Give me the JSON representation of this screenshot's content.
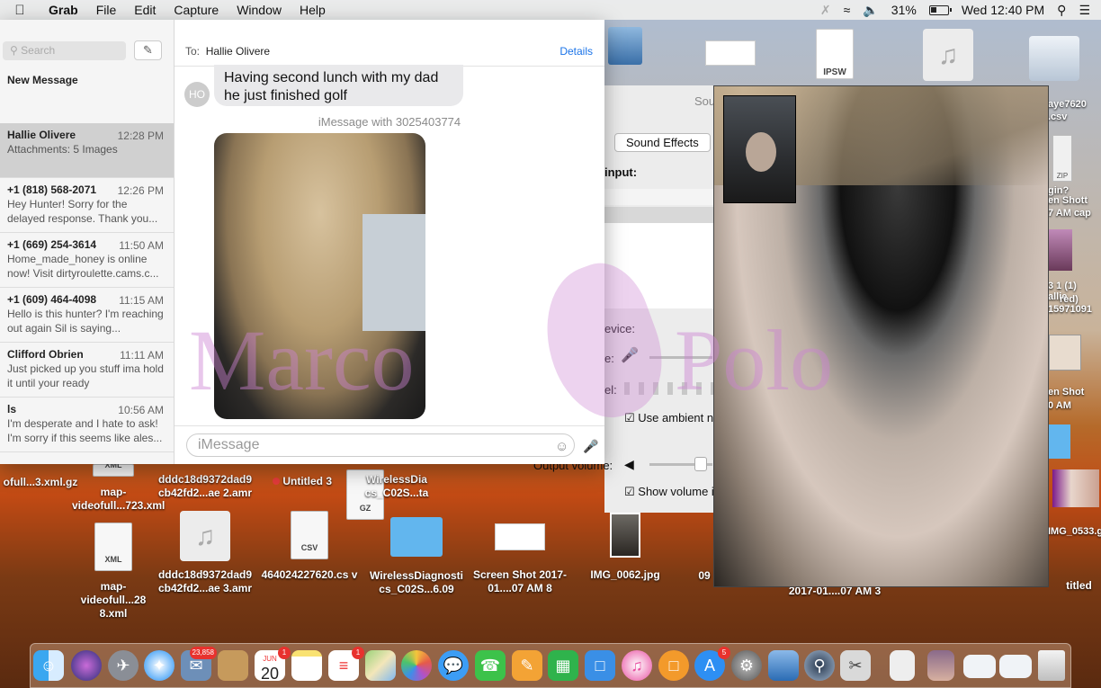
{
  "menubar": {
    "apple": "",
    "app_name": "Grab",
    "items": [
      "File",
      "Edit",
      "Capture",
      "Window",
      "Help"
    ],
    "battery": "31%",
    "clock": "Wed 12:40 PM"
  },
  "messages": {
    "search_placeholder": "Search",
    "new_message": "New Message",
    "conversations": [
      {
        "name": "Hallie Olivere",
        "time": "12:28 PM",
        "preview": "Attachments: 5 Images"
      },
      {
        "name": "+1 (818) 568-2071",
        "time": "12:26 PM",
        "preview": "Hey Hunter!  Sorry for the delayed response. Thank you..."
      },
      {
        "name": "+1 (669) 254-3614",
        "time": "11:50 AM",
        "preview": "Home_made_honey is online now! Visit dirtyroulette.cams.c..."
      },
      {
        "name": "+1 (609) 464-4098",
        "time": "11:15 AM",
        "preview": "Hello is this hunter?  I'm reaching out again Sil is saying..."
      },
      {
        "name": "Clifford Obrien",
        "time": "11:11 AM",
        "preview": "Just picked up you stuff ima hold it until your ready"
      },
      {
        "name": "ls",
        "time": "10:56 AM",
        "preview": "I'm desperate and I hate to ask! I'm sorry if this seems like ales..."
      }
    ],
    "to_label": "To:",
    "to_value": "Hallie Olivere",
    "details": "Details",
    "avatar_initials": "HO",
    "bubble_text": "Having second lunch with my dad he just finished golf",
    "imessage_header": "iMessage with 3025403774",
    "input_placeholder": "iMessage"
  },
  "sound_prefs": {
    "title": "Sou",
    "tab_label": "Sound Effects",
    "input_label": "input:",
    "device_label": "evice:",
    "e_label": "e:",
    "el_label": "el:",
    "ambient_label": "Use ambient n",
    "output_label": "Output volume:",
    "showvol_label": "Show volume i"
  },
  "desktop": {
    "row1": [
      {
        "label": "ofull...3.xml.gz"
      },
      {
        "label": "map-videofull...723.xml"
      },
      {
        "label": "dddc18d9372dad9 cb42fd2...ae 2.amr"
      },
      {
        "label": "Untitled 3"
      },
      {
        "label": "WirelessDia cs_C02S...ta"
      }
    ],
    "row2": [
      {
        "label": "map-videofull...28 8.xml"
      },
      {
        "label": "dddc18d9372dad9 cb42fd2...ae 3.amr"
      },
      {
        "label": "464024227620.cs v"
      },
      {
        "label": "WirelessDiagnosti cs_C02S...6.09"
      },
      {
        "label": "Screen Shot 2017-01....07 AM 8"
      },
      {
        "label": "IMG_0062.jpg"
      },
      {
        "label": "09"
      },
      {
        "label": "2017-01....07 AM 3"
      },
      {
        "label": "titled"
      }
    ],
    "file_types": [
      "XML",
      "CSV",
      "GZ",
      "IPSW",
      "ZIP"
    ],
    "right_column": [
      "aye7620",
      ".csv",
      "gin?",
      "en Shott",
      "7 AM cap",
      "3 1 (1)",
      "allie",
      "red)",
      "15971091",
      "en Shot",
      "0 AM",
      "IMG_0533.g"
    ]
  },
  "dock": {
    "badges": {
      "mail": "23,858",
      "calendar": "1",
      "reminders": "1",
      "appstore": "5"
    },
    "calendar_month": "JUN",
    "calendar_day": "20"
  },
  "watermark": {
    "word1": "Marco",
    "word2": "Polo"
  }
}
